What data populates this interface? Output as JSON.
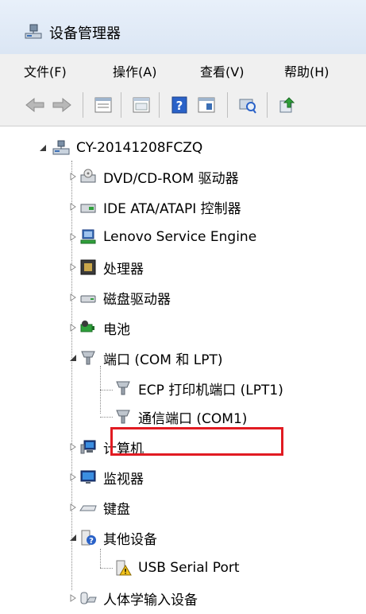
{
  "window": {
    "title": "设备管理器"
  },
  "menu": {
    "file": "文件(F)",
    "action": "操作(A)",
    "view": "查看(V)",
    "help": "帮助(H)"
  },
  "toolbar": {
    "icons": [
      "back-arrow-icon",
      "forward-arrow-icon",
      "properties-list-icon",
      "console-tree-icon",
      "help-icon",
      "device-view-icon",
      "scan-hardware-icon",
      "update-driver-icon"
    ]
  },
  "tree": {
    "root": "CY-20141208FCZQ",
    "items": [
      {
        "label": "DVD/CD-ROM 驱动器"
      },
      {
        "label": "IDE ATA/ATAPI 控制器"
      },
      {
        "label": "Lenovo Service Engine"
      },
      {
        "label": "处理器"
      },
      {
        "label": "磁盘驱动器"
      },
      {
        "label": "电池"
      },
      {
        "label": "端口 (COM 和 LPT)"
      },
      {
        "label": "ECP 打印机端口 (LPT1)"
      },
      {
        "label": "通信端口 (COM1)"
      },
      {
        "label": "计算机"
      },
      {
        "label": "监视器"
      },
      {
        "label": "键盘"
      },
      {
        "label": "其他设备"
      },
      {
        "label": "USB Serial Port"
      },
      {
        "label": "人体学输入设备"
      }
    ]
  },
  "colors": {
    "highlight": "#e11b22",
    "menubar": "#f0f0f0"
  }
}
